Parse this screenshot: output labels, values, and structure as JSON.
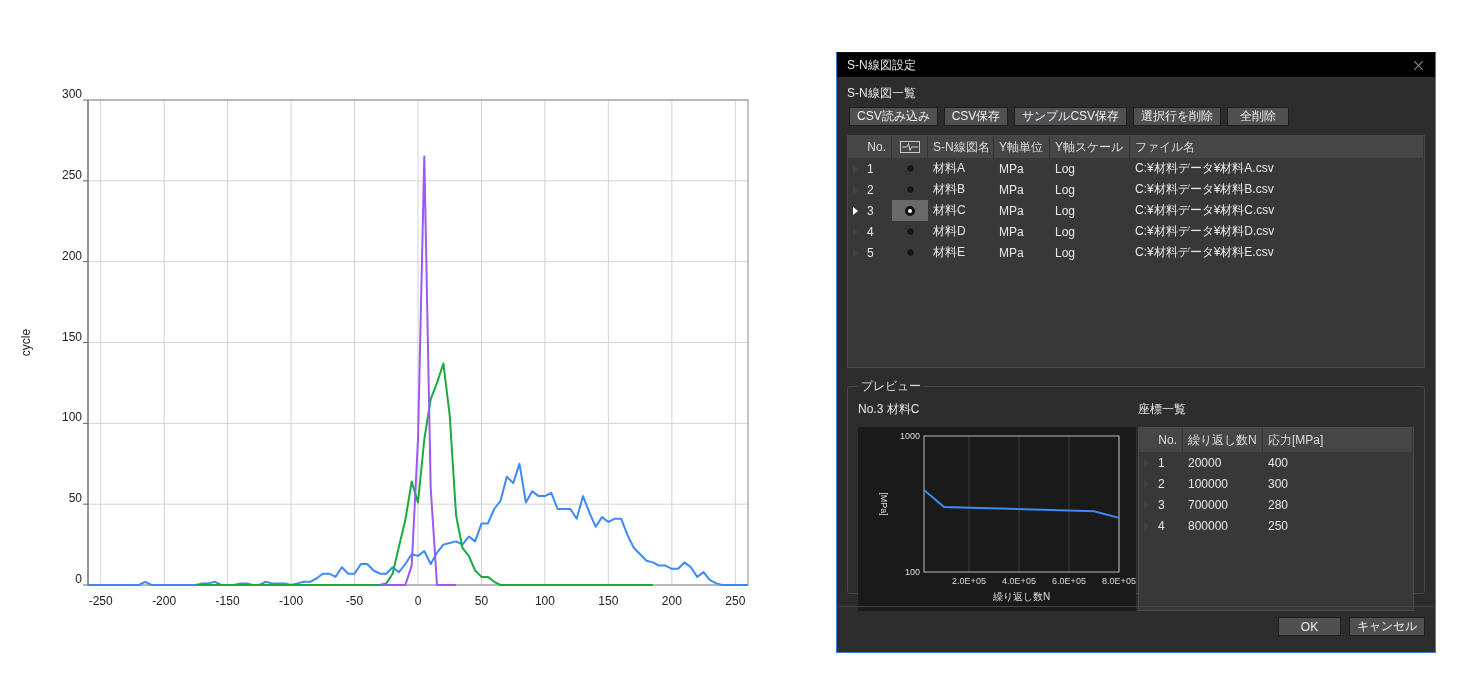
{
  "chart": {
    "chart_data": {
      "type": "line",
      "grid": true,
      "ylabel": "cycle",
      "x": [
        -260,
        -255,
        -250,
        -245,
        -240,
        -235,
        -230,
        -225,
        -220,
        -215,
        -210,
        -205,
        -200,
        -195,
        -190,
        -185,
        -180,
        -175,
        -170,
        -165,
        -160,
        -155,
        -150,
        -145,
        -140,
        -135,
        -130,
        -125,
        -120,
        -115,
        -110,
        -105,
        -100,
        -95,
        -90,
        -85,
        -80,
        -75,
        -70,
        -65,
        -60,
        -55,
        -50,
        -45,
        -40,
        -35,
        -30,
        -25,
        -20,
        -15,
        -10,
        -5,
        0,
        5,
        10,
        15,
        20,
        25,
        30,
        35,
        40,
        45,
        50,
        55,
        60,
        65,
        70,
        75,
        80,
        85,
        90,
        95,
        100,
        105,
        110,
        115,
        120,
        125,
        130,
        135,
        140,
        145,
        150,
        155,
        160,
        165,
        170,
        175,
        180,
        185,
        190,
        195,
        200,
        205,
        210,
        215,
        220,
        225,
        230,
        235,
        240,
        245,
        250,
        255,
        260
      ],
      "series": [
        {
          "color": "#3d8af7",
          "values": [
            0,
            0,
            0,
            0,
            0,
            0,
            0,
            0,
            0,
            2,
            0,
            0,
            0,
            0,
            0,
            0,
            0,
            0,
            1,
            1,
            2,
            0,
            0,
            0,
            1,
            1,
            0,
            0,
            2,
            1,
            1,
            1,
            0,
            1,
            2,
            2,
            4,
            7,
            7,
            5,
            11,
            7,
            7,
            13,
            13,
            9,
            7,
            7,
            11,
            8,
            13,
            19,
            18,
            21,
            13,
            20,
            25,
            26,
            27,
            25,
            30,
            27,
            38,
            38,
            47,
            52,
            67,
            63,
            75,
            51,
            58,
            55,
            55,
            57,
            47,
            47,
            47,
            41,
            55,
            45,
            36,
            42,
            39,
            41,
            41,
            31,
            23,
            19,
            15,
            14,
            12,
            12,
            10,
            10,
            14,
            11,
            5,
            8,
            3,
            1,
            0,
            0,
            0,
            0,
            0
          ]
        },
        {
          "color": "#1aab40",
          "values": [
            null,
            null,
            null,
            null,
            null,
            null,
            null,
            null,
            null,
            null,
            null,
            null,
            null,
            null,
            null,
            null,
            null,
            0,
            0,
            0,
            0,
            0,
            0,
            0,
            0,
            0,
            0,
            0,
            0,
            0,
            0,
            0,
            0,
            0,
            0,
            0,
            0,
            0,
            0,
            0,
            0,
            0,
            0,
            0,
            0,
            0,
            0,
            1,
            7,
            24,
            40,
            64,
            51,
            90,
            115,
            125,
            137,
            105,
            43,
            23,
            18,
            9,
            5,
            5,
            2,
            0,
            0,
            0,
            0,
            0,
            0,
            0,
            0,
            0,
            0,
            0,
            0,
            0,
            0,
            0,
            0,
            0,
            0,
            0,
            0,
            0,
            0,
            0,
            0,
            0,
            null,
            null,
            null,
            null,
            null,
            null,
            null,
            null,
            null,
            null,
            null,
            null,
            null,
            null,
            null
          ]
        },
        {
          "color": "#9b59f5",
          "values": [
            null,
            null,
            null,
            null,
            null,
            null,
            null,
            null,
            null,
            null,
            null,
            null,
            null,
            null,
            null,
            null,
            null,
            null,
            null,
            null,
            null,
            null,
            null,
            null,
            null,
            null,
            null,
            null,
            null,
            null,
            null,
            null,
            null,
            null,
            null,
            null,
            null,
            null,
            null,
            null,
            null,
            null,
            null,
            null,
            null,
            null,
            0,
            0,
            0,
            0,
            0,
            12,
            90,
            265,
            60,
            0,
            0,
            0,
            0,
            null,
            null,
            null,
            null,
            null,
            null,
            null,
            null,
            null,
            null,
            null,
            null,
            null,
            null,
            null,
            null,
            null,
            null,
            null,
            null,
            null,
            null,
            null,
            null,
            null,
            null,
            null,
            null,
            null,
            null,
            null,
            null,
            null,
            null,
            null,
            null,
            null,
            null,
            null,
            null,
            null,
            null,
            null,
            null,
            null,
            null
          ]
        }
      ],
      "xlim": [
        -260,
        260
      ],
      "ylim": [
        0,
        300
      ],
      "xticks": [
        -250,
        -200,
        -150,
        -100,
        -50,
        0,
        50,
        100,
        150,
        200,
        250
      ],
      "yticks": [
        0,
        50,
        100,
        150,
        200,
        250,
        300
      ]
    }
  },
  "dialog": {
    "title": "S-N線図設定",
    "section_title": "S-N線図一覧",
    "toolbar_buttons": [
      "CSV読み込み",
      "CSV保存",
      "サンプルCSV保存",
      "選択行を削除",
      "全削除"
    ],
    "sn_table": {
      "columns": [
        {
          "kind": "text",
          "label": "No."
        },
        {
          "kind": "icon"
        },
        {
          "kind": "text",
          "label": "S-N線図名"
        },
        {
          "kind": "text",
          "label": "Y軸単位"
        },
        {
          "kind": "text",
          "label": "Y軸スケール"
        },
        {
          "kind": "text",
          "label": "ファイル名"
        }
      ],
      "rows": [
        {
          "no": "1",
          "selected": false,
          "name": "材料A",
          "unit": "MPa",
          "scale": "Log",
          "file": "C:¥材料データ¥材料A.csv"
        },
        {
          "no": "2",
          "selected": false,
          "name": "材料B",
          "unit": "MPa",
          "scale": "Log",
          "file": "C:¥材料データ¥材料B.csv"
        },
        {
          "no": "3",
          "selected": true,
          "name": "材料C",
          "unit": "MPa",
          "scale": "Log",
          "file": "C:¥材料データ¥材料C.csv"
        },
        {
          "no": "4",
          "selected": false,
          "name": "材料D",
          "unit": "MPa",
          "scale": "Log",
          "file": "C:¥材料データ¥材料D.csv"
        },
        {
          "no": "5",
          "selected": false,
          "name": "材料E",
          "unit": "MPa",
          "scale": "Log",
          "file": "C:¥材料データ¥材料E.csv"
        }
      ]
    },
    "preview": {
      "legend": "プレビュー",
      "title": "No.3 材料C",
      "preview_chart": {
        "xlabel": "繰り返し数N",
        "ylabel": "[MPa]",
        "x_tick_labels": [
          "2.0E+05",
          "4.0E+05",
          "6.0E+05",
          "8.0E+05"
        ],
        "y_tick_labels": [
          "1000",
          "100"
        ]
      },
      "coords_title": "座標一覧",
      "coords_table": {
        "columns": [
          "No.",
          "繰り返し数N",
          "応力[MPa]"
        ],
        "rows": [
          {
            "no": "1",
            "n": "20000",
            "stress": "400"
          },
          {
            "no": "2",
            "n": "100000",
            "stress": "300"
          },
          {
            "no": "3",
            "n": "700000",
            "stress": "280"
          },
          {
            "no": "4",
            "n": "800000",
            "stress": "250"
          }
        ]
      }
    },
    "footer_buttons": [
      "OK",
      "キャンセル"
    ]
  }
}
